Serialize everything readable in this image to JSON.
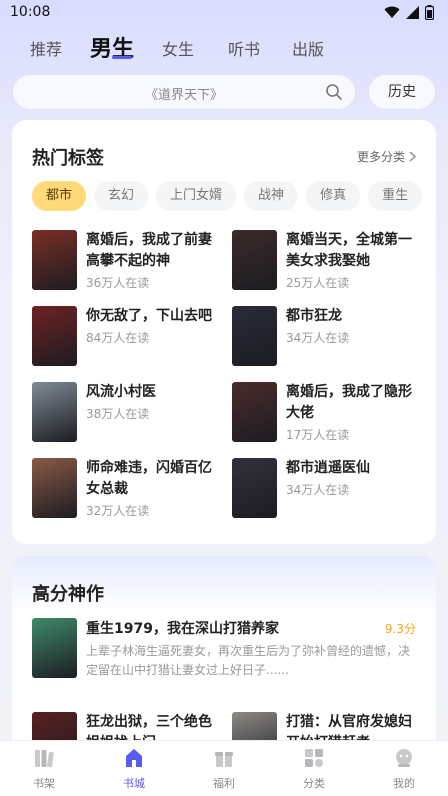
{
  "status": {
    "time": "10:08"
  },
  "tabs": [
    {
      "label": "推荐"
    },
    {
      "label": "男生"
    },
    {
      "label": "女生"
    },
    {
      "label": "听书"
    },
    {
      "label": "出版"
    }
  ],
  "search": {
    "placeholder": "《道界天下》",
    "history_label": "历史"
  },
  "hot": {
    "title": "热门标签",
    "more": "更多分类",
    "chips": [
      "都市",
      "玄幻",
      "上门女婿",
      "战神",
      "修真",
      "重生"
    ],
    "books": [
      {
        "title": "离婚后，我成了前妻高攀不起的神",
        "reads": "36万人在读",
        "cover_color": "#7a2f25"
      },
      {
        "title": "离婚当天，全城第一美女求我娶她",
        "reads": "25万人在读",
        "cover_color": "#3b2a2a"
      },
      {
        "title": "你无敌了，下山去吧",
        "reads": "84万人在读",
        "cover_color": "#6e2222"
      },
      {
        "title": "都市狂龙",
        "reads": "34万人在读",
        "cover_color": "#2a2a3a"
      },
      {
        "title": "风流小村医",
        "reads": "38万人在读",
        "cover_color": "#7f8b95"
      },
      {
        "title": "离婚后，我成了隐形大佬",
        "reads": "17万人在读",
        "cover_color": "#4a2b2b"
      },
      {
        "title": "师命难违，闪婚百亿女总裁",
        "reads": "32万人在读",
        "cover_color": "#8a5a45"
      },
      {
        "title": "都市逍遥医仙",
        "reads": "34万人在读",
        "cover_color": "#33313a"
      }
    ]
  },
  "high": {
    "title": "高分神作",
    "feature": {
      "title": "重生1979，我在深山打猎养家",
      "score": "9.3分",
      "desc": "上辈子林海生逼死妻女，再次重生后为了弥补曾经的遗憾，决定留在山中打猎让妻女过上好日子......",
      "cover_color": "#3f8a6a"
    },
    "more_books": [
      {
        "title": "狂龙出狱，三个绝色姐姐找上门",
        "cover_color": "#5a2020"
      },
      {
        "title": "打猎：从官府发媳妇开始打猎赶考",
        "cover_color": "#8d8a86"
      }
    ]
  },
  "nav": [
    {
      "label": "书架",
      "icon": "bookshelf-icon"
    },
    {
      "label": "书城",
      "icon": "bookstore-icon"
    },
    {
      "label": "福利",
      "icon": "gift-icon"
    },
    {
      "label": "分类",
      "icon": "category-icon"
    },
    {
      "label": "我的",
      "icon": "profile-icon"
    }
  ],
  "colors": {
    "accent": "#5a5cf0",
    "chip_active": "#ffd97a",
    "score": "#f5a623"
  }
}
